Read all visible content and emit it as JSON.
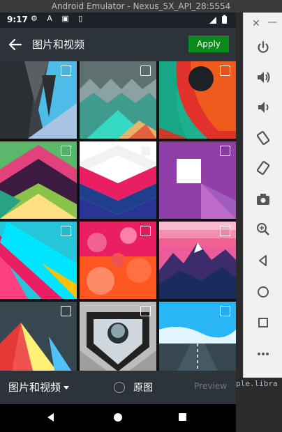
{
  "window": {
    "title": "Android Emulator - Nexus_5X_API_28:5554"
  },
  "status_bar": {
    "time": "9:17",
    "icons": "⚙ A ▣ ▯"
  },
  "app_bar": {
    "title": "图片和视频",
    "apply_label": "Apply"
  },
  "bottom_bar": {
    "album_label": "图片和视频",
    "original_label": "原图",
    "preview_label": "Preview"
  },
  "editor": {
    "line1": "ple.libra"
  },
  "grid": {
    "tiles": [
      {
        "name": "abstract-1"
      },
      {
        "name": "abstract-2"
      },
      {
        "name": "abstract-3"
      },
      {
        "name": "abstract-4"
      },
      {
        "name": "abstract-5"
      },
      {
        "name": "abstract-6"
      },
      {
        "name": "abstract-7"
      },
      {
        "name": "abstract-8"
      },
      {
        "name": "abstract-9"
      },
      {
        "name": "abstract-10"
      },
      {
        "name": "abstract-11"
      },
      {
        "name": "abstract-12"
      }
    ]
  },
  "colors": {
    "accent": "#0b8a1a",
    "toolbar": "#2c3339"
  }
}
